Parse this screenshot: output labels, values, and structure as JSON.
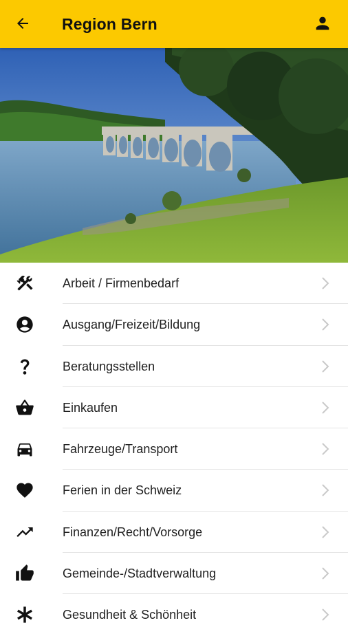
{
  "appbar": {
    "title": "Region Bern",
    "back_icon": "arrow-back-icon",
    "account_icon": "account-icon",
    "color": "#fcc900"
  },
  "hero": {
    "description_icon": "lake-bridge-photo"
  },
  "categories": [
    {
      "label": "Arbeit / Firmenbedarf",
      "icon": "tools-icon"
    },
    {
      "label": "Ausgang/Freizeit/Bildung",
      "icon": "person-circle-icon"
    },
    {
      "label": "Beratungsstellen",
      "icon": "question-icon"
    },
    {
      "label": "Einkaufen",
      "icon": "basket-icon"
    },
    {
      "label": "Fahrzeuge/Transport",
      "icon": "car-icon"
    },
    {
      "label": "Ferien in der Schweiz",
      "icon": "heart-icon"
    },
    {
      "label": "Finanzen/Recht/Vorsorge",
      "icon": "trending-up-icon"
    },
    {
      "label": "Gemeinde-/Stadtverwaltung",
      "icon": "thumbs-up-icon"
    },
    {
      "label": "Gesundheit & Schönheit",
      "icon": "asterisk-icon"
    }
  ]
}
